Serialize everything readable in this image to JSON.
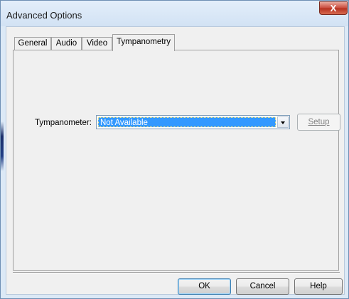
{
  "window": {
    "title": "Advanced Options",
    "close_glyph": "X"
  },
  "tabs": [
    {
      "label": "General",
      "active": false
    },
    {
      "label": "Audio",
      "active": false
    },
    {
      "label": "Video",
      "active": false
    },
    {
      "label": "Tympanometry",
      "active": true
    }
  ],
  "tympanometry": {
    "label": "Tympanometer:",
    "selected": "Not Available",
    "setup_label": "Setup",
    "setup_enabled": false
  },
  "footer": {
    "ok_label": "OK",
    "cancel_label": "Cancel",
    "help_label": "Help"
  },
  "colors": {
    "selection": "#3399ff",
    "close_button": "#c9483a",
    "frame": "#dce9f6"
  }
}
